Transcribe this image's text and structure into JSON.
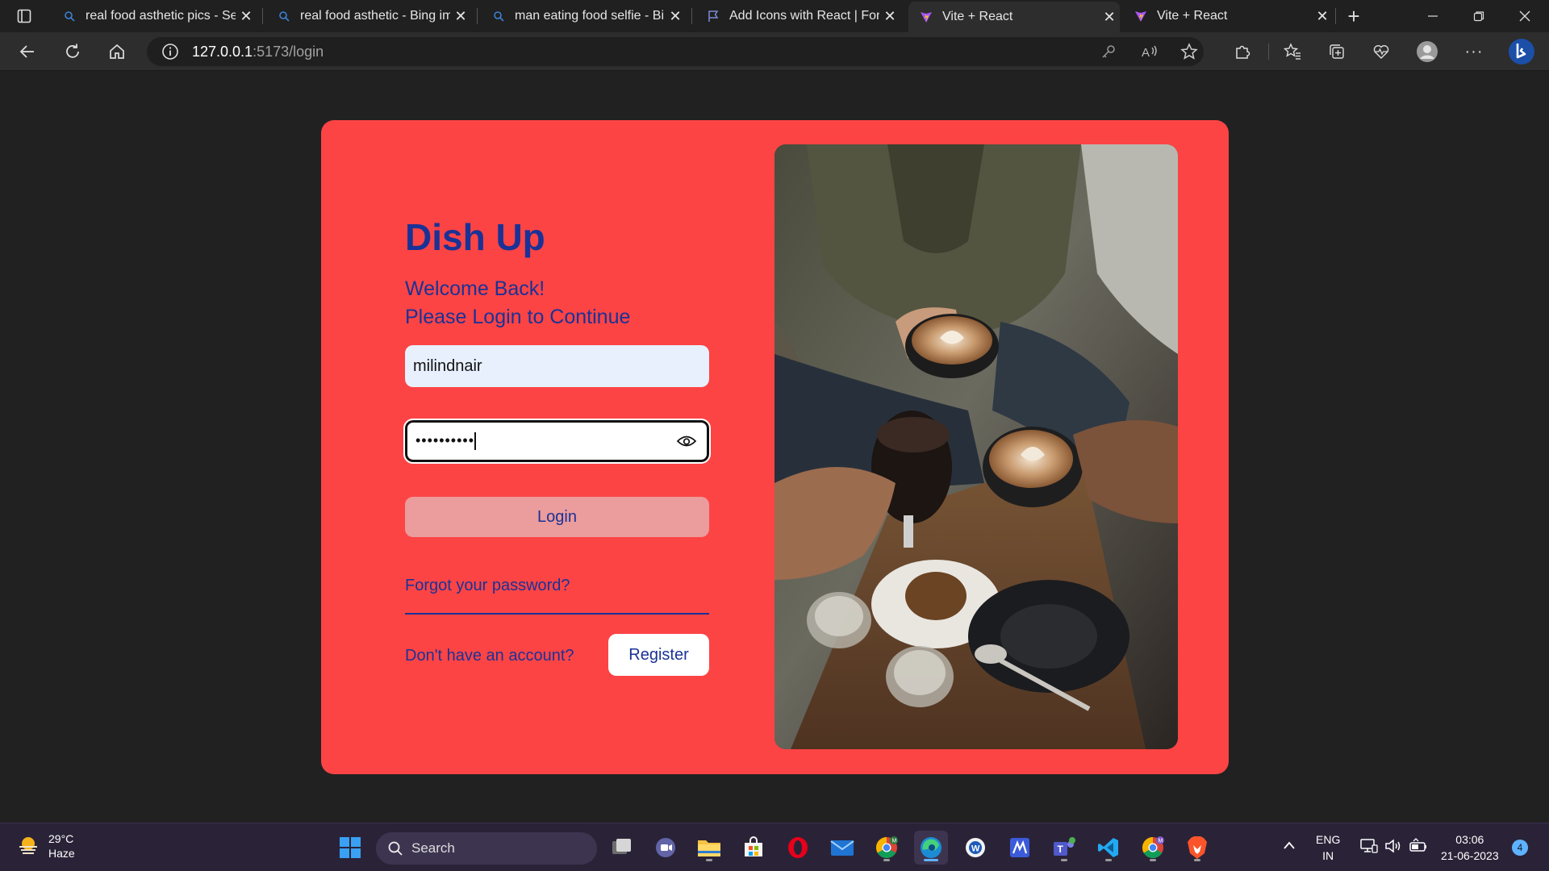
{
  "browser": {
    "tabs": [
      {
        "title": "real food asthetic pics - Sea",
        "icon": "search-icon"
      },
      {
        "title": "real food asthetic - Bing ima",
        "icon": "search-icon"
      },
      {
        "title": "man eating food selfie - Bin",
        "icon": "search-icon"
      },
      {
        "title": "Add Icons with React | Font",
        "icon": "flag-icon"
      },
      {
        "title": "Vite + React",
        "icon": "vite-icon"
      },
      {
        "title": "Vite + React",
        "icon": "vite-icon"
      }
    ],
    "url_host": "127.0.0.1",
    "url_rest": ":5173/login"
  },
  "login": {
    "brand": "Dish Up",
    "welcome_line1": "Welcome Back!",
    "welcome_line2": "Please Login to Continue",
    "username_value": "milindnair",
    "password_masked": "••••••••••",
    "login_label": "Login",
    "forgot_label": "Forgot your password?",
    "no_account_label": "Don't have an account?",
    "register_label": "Register"
  },
  "colors": {
    "card_bg": "#fc4445",
    "accent_text": "#1a3296",
    "login_btn_bg": "#eb9c9c",
    "page_bg": "#212121"
  },
  "taskbar": {
    "temperature": "29°C",
    "condition": "Haze",
    "search_label": "Search",
    "lang1": "ENG",
    "lang2": "IN",
    "time": "03:06",
    "date": "21-06-2023",
    "notification_count": "4"
  }
}
